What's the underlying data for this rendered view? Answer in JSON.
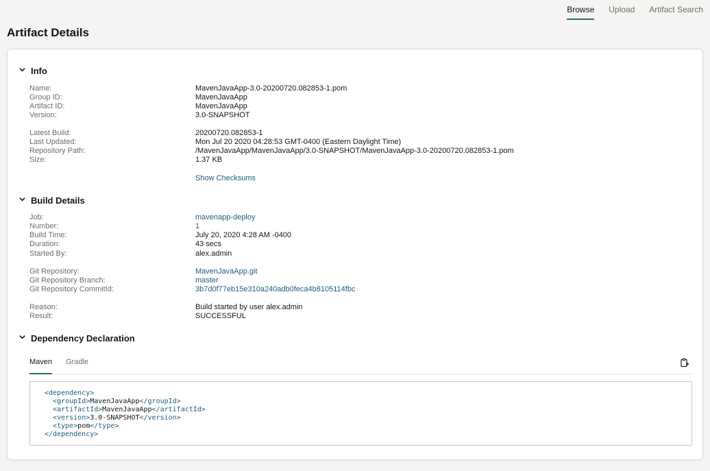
{
  "topnav": {
    "tabs": [
      {
        "label": "Browse",
        "active": true
      },
      {
        "label": "Upload",
        "active": false
      },
      {
        "label": "Artifact Search",
        "active": false
      }
    ]
  },
  "page": {
    "title": "Artifact Details"
  },
  "info": {
    "heading": "Info",
    "labels": {
      "name": "Name:",
      "group_id": "Group ID:",
      "artifact_id": "Artifact ID:",
      "version": "Version:",
      "latest_build": "Latest Build:",
      "last_updated": "Last Updated:",
      "repository_path": "Repository Path:",
      "size": "Size:"
    },
    "values": {
      "name": "MavenJavaApp-3.0-20200720.082853-1.pom",
      "group_id": "MavenJavaApp",
      "artifact_id": "MavenJavaApp",
      "version": "3.0-SNAPSHOT",
      "latest_build": "20200720.082853-1",
      "last_updated": "Mon Jul 20 2020 04:28:53 GMT-0400 (Eastern Daylight Time)",
      "repository_path": "/MavenJavaApp/MavenJavaApp/3.0-SNAPSHOT/MavenJavaApp-3.0-20200720.082853-1.pom",
      "size": "1.37 KB"
    },
    "show_checksums": "Show Checksums"
  },
  "build": {
    "heading": "Build Details",
    "labels": {
      "job": "Job:",
      "number": "Number:",
      "build_time": "Build Time:",
      "duration": "Duration:",
      "started_by": "Started By:",
      "git_repository": "Git Repository:",
      "git_branch": "Git Repository Branch:",
      "git_commit": "Git Repository CommitId:",
      "reason": "Reason:",
      "result": "Result:"
    },
    "values": {
      "job": "mavenapp-deploy",
      "number": "1",
      "build_time": "July 20, 2020 4:28 AM -0400",
      "duration": "43 secs",
      "started_by": "alex.admin",
      "git_repository": "MavenJavaApp.git",
      "git_branch": "master",
      "git_commit": "3b7d0f77eb15e310a240adb0feca4b8105114fbc",
      "reason": "Build started by user alex.admin",
      "result": "SUCCESSFUL"
    }
  },
  "dependency": {
    "heading": "Dependency Declaration",
    "tabs": [
      {
        "label": "Maven",
        "active": true
      },
      {
        "label": "Gradle",
        "active": false
      }
    ],
    "copy_icon": "copy-to-clipboard-icon",
    "code": {
      "open_dep": "<dependency>",
      "group_open": "<groupId>",
      "group_val": "MavenJavaApp",
      "group_close": "</groupId>",
      "artifact_open": "<artifactId>",
      "artifact_val": "MavenJavaApp",
      "artifact_close": "</artifactId>",
      "version_open": "<version>",
      "version_val": "3.0-SNAPSHOT",
      "version_close": "</version>",
      "type_open": "<type>",
      "type_val": "pom",
      "type_close": "</type>",
      "close_dep": "</dependency>"
    }
  },
  "colors": {
    "accent": "#2f6b5e",
    "link": "#1d5b7c",
    "label": "#6f6c67"
  }
}
